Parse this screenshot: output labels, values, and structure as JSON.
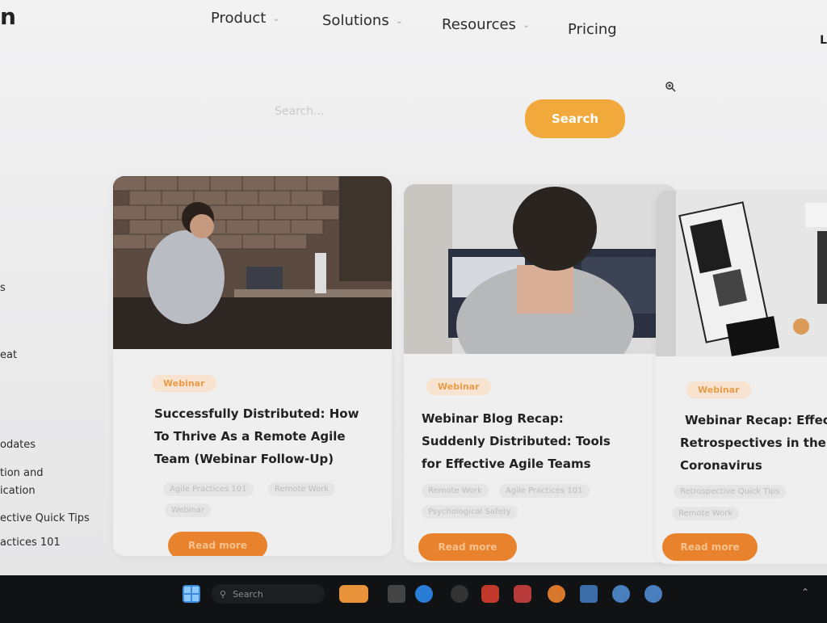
{
  "nav": {
    "logo_fragment": "n",
    "items": [
      {
        "label": "Product",
        "has_dropdown": true
      },
      {
        "label": "Solutions",
        "has_dropdown": true
      },
      {
        "label": "Resources",
        "has_dropdown": true
      },
      {
        "label": "Pricing",
        "has_dropdown": false
      }
    ],
    "login_fragment": "L"
  },
  "search": {
    "placeholder": "Search...",
    "button_label": "Search"
  },
  "sidebar": {
    "items": [
      "s",
      "eat",
      "odates",
      "tion and",
      "ication",
      "ective Quick Tips",
      "actices 101"
    ]
  },
  "cards": [
    {
      "badge": "Webinar",
      "title_lines": [
        "Successfully Distributed: How",
        "To Thrive As a Remote Agile",
        "Team (Webinar Follow-Up)"
      ],
      "tags": [
        "Agile Practices 101",
        "Remote Work",
        "Webinar"
      ],
      "button": "Read more"
    },
    {
      "badge": "Webinar",
      "title_lines": [
        "Webinar Blog Recap:",
        "Suddenly Distributed: Tools",
        "for Effective Agile Teams"
      ],
      "tags": [
        "Remote Work",
        "Agile Practices 101",
        "Psychological Safety"
      ],
      "button": "Read more"
    },
    {
      "badge": "Webinar",
      "title_lines": [
        "Webinar Recap: Effect",
        "Retrospectives in the A",
        "Coronavirus"
      ],
      "tags": [
        "Retrospective Quick Tips",
        "Remote Work"
      ],
      "button": "Read more"
    }
  ],
  "taskbar": {
    "search_label": "Search"
  },
  "colors": {
    "accent": "#f2a93b",
    "button": "#e8822c",
    "badge_bg": "#f7e3cf",
    "badge_text": "#e79c4a"
  }
}
